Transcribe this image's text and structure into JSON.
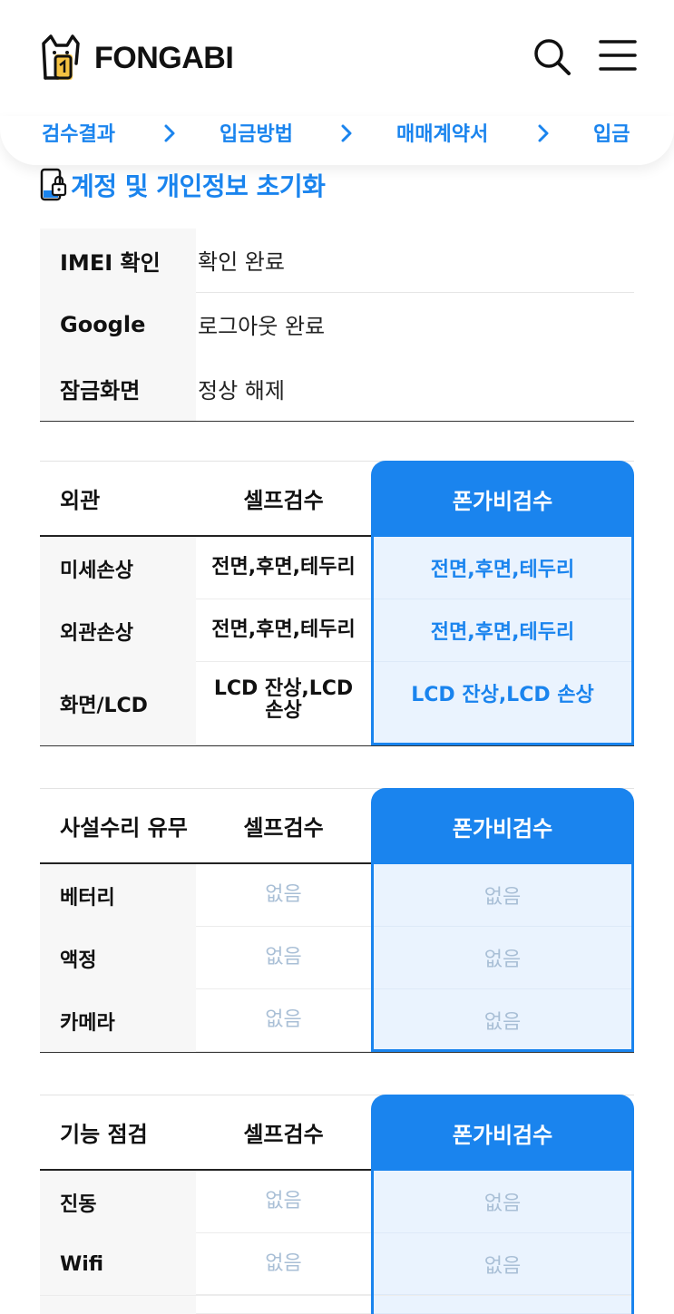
{
  "header": {
    "logo_text": "FONGABI",
    "search_icon": "search-icon",
    "menu_icon": "hamburger-menu-icon"
  },
  "steps": [
    "검수결과",
    "입금방법",
    "매매계약서",
    "입금"
  ],
  "section_title": "계정 및 개인정보 초기화",
  "account": [
    {
      "label": "IMEI 확인",
      "value": "확인 완료"
    },
    {
      "label": "Google",
      "value": "로그아웃 완료"
    },
    {
      "label": "잠금화면",
      "value": "정상 해제"
    }
  ],
  "appearance": {
    "header": {
      "label": "외관",
      "self": "셀프검수",
      "fongabi": "폰가비검수"
    },
    "rows": [
      {
        "label": "미세손상",
        "self": "전면,후면,테두리",
        "fongabi": "전면,후면,테두리"
      },
      {
        "label": "외관손상",
        "self": "전면,후면,테두리",
        "fongabi": "전면,후면,테두리"
      },
      {
        "label": "화면/LCD",
        "self": "LCD 잔상,LCD 손상",
        "fongabi": "LCD 잔상,LCD 손상"
      }
    ]
  },
  "repair": {
    "header": {
      "label": "사설수리 유무",
      "self": "셀프검수",
      "fongabi": "폰가비검수"
    },
    "rows": [
      {
        "label": "베터리",
        "self": "없음",
        "fongabi": "없음"
      },
      {
        "label": "액정",
        "self": "없음",
        "fongabi": "없음"
      },
      {
        "label": "카메라",
        "self": "없음",
        "fongabi": "없음"
      }
    ]
  },
  "function": {
    "header": {
      "label": "기능 점검",
      "self": "셀프검수",
      "fongabi": "폰가비검수"
    },
    "rows": [
      {
        "label": "진동",
        "self": "없음",
        "fongabi": "없음"
      },
      {
        "label": "Wifi",
        "self": "없음",
        "fongabi": "없음"
      }
    ]
  },
  "colors": {
    "accent": "#1a84ee",
    "accent_light": "#eaf3fe",
    "muted": "#a9bfd6"
  }
}
